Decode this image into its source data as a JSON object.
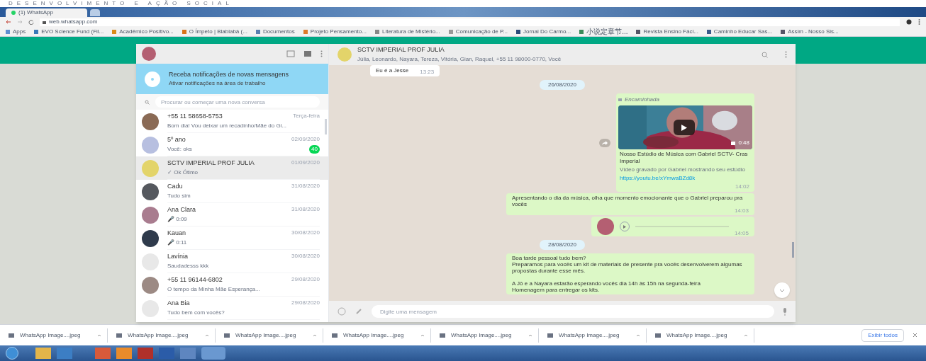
{
  "page_heading": "DESENVOLVIMENTO E AÇÃO SOCIAL",
  "browser": {
    "tabs": [
      {
        "label": "(1) WhatsApp",
        "selected": true
      }
    ],
    "url": "web.whatsapp.com",
    "bookmarks": [
      "Apps",
      "EVO Science Fund (Fil...",
      "Acadêmico Positivo...",
      "O Ímpeto | Blablabá (...",
      "Documentos",
      "Projeto Pensamento...",
      "Literatura de Mistério...",
      "Comunicação de P...",
      "Jornal Do Carmo...",
      "小说定章节...",
      "Revista Ensino Fáci...",
      "Caminho Educar Sas...",
      "Assim - Nosso Sis..."
    ]
  },
  "sidebar": {
    "notification": {
      "title": "Receba notificações de novas mensagens",
      "subtitle": "Ativar notificações na área de trabalho"
    },
    "search": {
      "placeholder": "Procurar ou começar uma nova conversa"
    },
    "chats": [
      {
        "name": "+55 11 58658-5753",
        "preview": "Bom dia! Vou deixar um recadinho/Mãe do Gi...",
        "time": "Terça-feira",
        "selected": false
      },
      {
        "name": "5º ano",
        "preview": "Você: oks",
        "time": "02/09/2020",
        "unread": "40",
        "selected": false
      },
      {
        "name": "SCTV IMPERIAL PROF JULIA",
        "preview": "✓ Ok Ótimo",
        "time": "01/09/2020",
        "selected": true
      },
      {
        "name": "Cadu",
        "preview": "Tudo sim",
        "time": "31/08/2020",
        "selected": false
      },
      {
        "name": "Ana Clara",
        "preview": "🎤 0:09",
        "time": "31/08/2020",
        "selected": false
      },
      {
        "name": "Kauan",
        "preview": "🎤 0:11",
        "time": "30/08/2020",
        "selected": false
      },
      {
        "name": "Lavínia",
        "preview": "Saudadesss kkk",
        "time": "30/08/2020",
        "selected": false
      },
      {
        "name": "+55 11 96144-6802",
        "preview": "O tempo da Minha Mãe Esperança...",
        "time": "29/08/2020",
        "selected": false
      },
      {
        "name": "Ana Bia",
        "preview": "Tudo bem com vocês?",
        "time": "29/08/2020",
        "selected": false
      }
    ]
  },
  "chat": {
    "title": "SCTV IMPERIAL PROF JULIA",
    "members": "Júlia, Leonardo, Nayara, Tereza, Vitória, Gian, Raquel, +55 11 98000-0770, Você",
    "messages": [
      {
        "kind": "incoming",
        "text": "Eu é a Jesse",
        "time": "13:23"
      },
      {
        "kind": "date",
        "text": "26/08/2020"
      },
      {
        "kind": "video",
        "forwarded": "Encaminhada",
        "duration": "0:48",
        "title": "Nosso Estúdio de Música com Gabriel SCTV- Cras Imperial",
        "description": "Vídeo gravado por Gabriel mostrando seu estúdio",
        "link": "https://youtu.be/xYmwaBZd8k",
        "time": "14:02"
      },
      {
        "kind": "outgoing",
        "text": "Apresentando o dia da música, olha que momento emocionante que o Gabriel preparou pra vocês",
        "time": "14:03"
      },
      {
        "kind": "audio",
        "time": "14:05"
      },
      {
        "kind": "date",
        "text": "28/08/2020"
      },
      {
        "kind": "outgoing",
        "text": "Boa tarde pessoal tudo bem?\nPreparamos para vocês um kit de materiais de presente pra vocês desenvolverem algumas propostas durante esse mês.\n\nA Jô e a Nayara estarão esperando vocês dia 14h às 15h na segunda-feira\nHomenagem para entregar os kits."
      }
    ],
    "composer": {
      "placeholder": "Digite uma mensagem"
    }
  },
  "downloads": {
    "items": [
      "WhatsApp Image....jpeg",
      "WhatsApp Image....jpeg",
      "WhatsApp Image....jpeg",
      "WhatsApp Image....jpeg",
      "WhatsApp Image....jpeg",
      "WhatsApp Image....jpeg",
      "WhatsApp Image....jpeg"
    ],
    "show_all": "Exibir todos"
  }
}
